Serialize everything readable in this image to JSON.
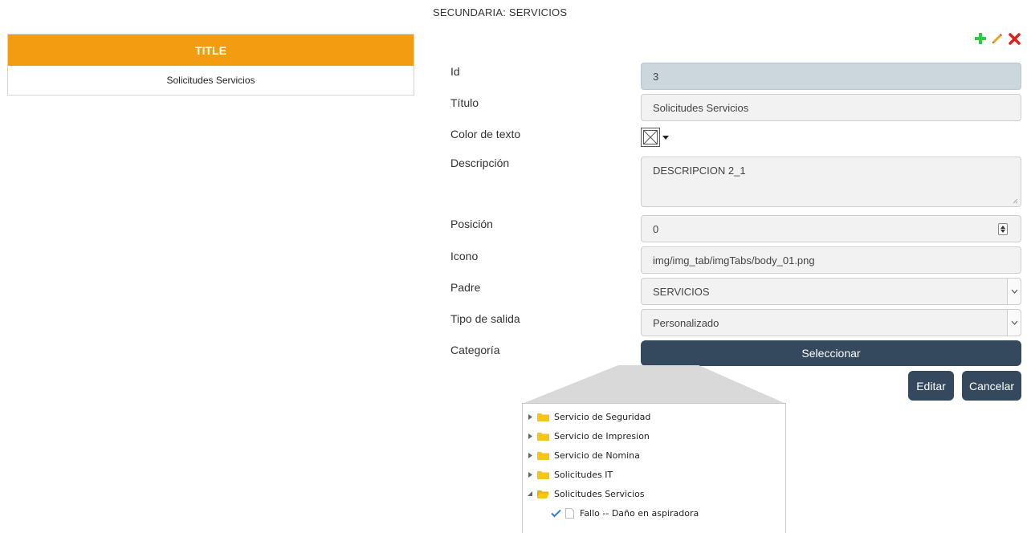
{
  "header": {
    "title": "SECUNDARIA: SERVICIOS"
  },
  "list": {
    "column_header": "TITLE",
    "rows": [
      "Solicitudes Servicios"
    ]
  },
  "toolbar": {
    "add_icon": "plus-icon",
    "edit_icon": "pencil-icon",
    "delete_icon": "close-icon"
  },
  "form": {
    "id": {
      "label": "Id",
      "value": "3"
    },
    "titulo": {
      "label": "Título",
      "value": "Solicitudes Servicios"
    },
    "color": {
      "label": "Color de texto"
    },
    "descripcion": {
      "label": "Descripción",
      "value": "DESCRIPCION 2_1"
    },
    "posicion": {
      "label": "Posición",
      "value": "0"
    },
    "icono": {
      "label": "Icono",
      "value": "img/img_tab/imgTabs/body_01.png"
    },
    "padre": {
      "label": "Padre",
      "value": "SERVICIOS"
    },
    "tipo_salida": {
      "label": "Tipo de salida",
      "value": "Personalizado"
    },
    "categoria": {
      "label": "Categoría",
      "button": "Seleccionar"
    }
  },
  "actions": {
    "edit": "Editar",
    "cancel": "Cancelar"
  },
  "tree": {
    "items": [
      {
        "label": "Servicio de Seguridad",
        "expanded": false
      },
      {
        "label": "Servicio de Impresion",
        "expanded": false
      },
      {
        "label": "Servicio de Nomina",
        "expanded": false
      },
      {
        "label": "Solicitudes IT",
        "expanded": false
      },
      {
        "label": "Solicitudes Servicios",
        "expanded": true
      }
    ],
    "child": {
      "label": "Fallo -- Daño en aspiradora",
      "checked": true
    }
  },
  "colors": {
    "accent_orange": "#f39c12",
    "button_dark": "#34495e",
    "add_green": "#2ecc40",
    "delete_red": "#e0201a",
    "folder_yellow": "#f5c518"
  }
}
